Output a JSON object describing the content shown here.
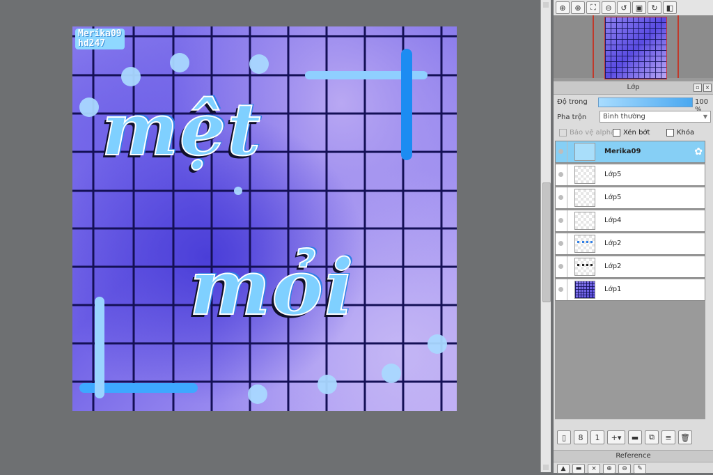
{
  "canvas": {
    "signature_line1": "Merika09",
    "signature_line2": "hd247",
    "word1": "mệt",
    "word2": "mỏi"
  },
  "navigator": {
    "tools": [
      "zoom-fit-icon",
      "zoom-in-icon",
      "fit-screen-icon",
      "zoom-out-icon",
      "rotate-left-icon",
      "fit-window-icon",
      "rotate-right-icon",
      "flip-icon"
    ]
  },
  "layer_panel": {
    "title": "Lớp",
    "opacity_label": "Độ trong",
    "opacity_value": "100 %",
    "blend_label": "Pha trộn",
    "blend_value": "Bình thường",
    "protect_alpha": "Bảo vệ alpha",
    "clipping": "Xén bớt",
    "lock": "Khóa",
    "layers": [
      {
        "name": "Merika09",
        "selected": true
      },
      {
        "name": "Lớp5",
        "selected": false
      },
      {
        "name": "Lớp5",
        "selected": false
      },
      {
        "name": "Lớp4",
        "selected": false
      },
      {
        "name": "Lớp2",
        "selected": false
      },
      {
        "name": "Lớp2",
        "selected": false
      },
      {
        "name": "Lớp1",
        "selected": false
      }
    ]
  },
  "reference_panel": {
    "title": "Reference"
  }
}
